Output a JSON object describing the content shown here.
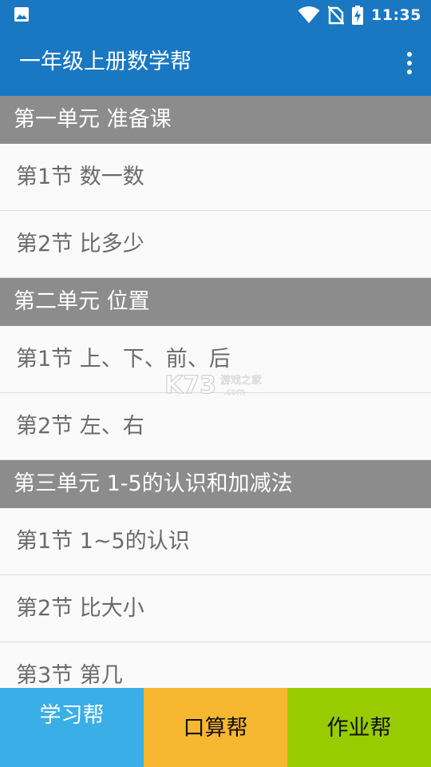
{
  "status_bar": {
    "time": "11:35",
    "icons": [
      "image-icon",
      "wifi-icon",
      "no-sim-icon",
      "battery-charging-icon"
    ],
    "background": "#1a78c2"
  },
  "app_bar": {
    "title": "一年级上册数学帮",
    "menu_icon": "more-vert-icon",
    "background": "#1a78c2"
  },
  "sections": [
    {
      "title": "第一单元 准备课",
      "lessons": [
        "第1节 数一数",
        "第2节 比多少"
      ]
    },
    {
      "title": "第二单元 位置",
      "lessons": [
        "第1节 上、下、前、后",
        "第2节 左、右"
      ]
    },
    {
      "title": "第三单元 1-5的认识和加减法",
      "lessons": [
        "第1节 1~5的认识",
        "第2节 比大小",
        "第3节 第几"
      ]
    }
  ],
  "watermark": {
    "text": "K73",
    "subtext": "游戏之家",
    "url_text": ".com"
  },
  "tabs": [
    {
      "label": "学习帮",
      "color": "#3aaee6"
    },
    {
      "label": "口算帮",
      "color": "#f7b731"
    },
    {
      "label": "作业帮",
      "color": "#99cc00"
    }
  ]
}
